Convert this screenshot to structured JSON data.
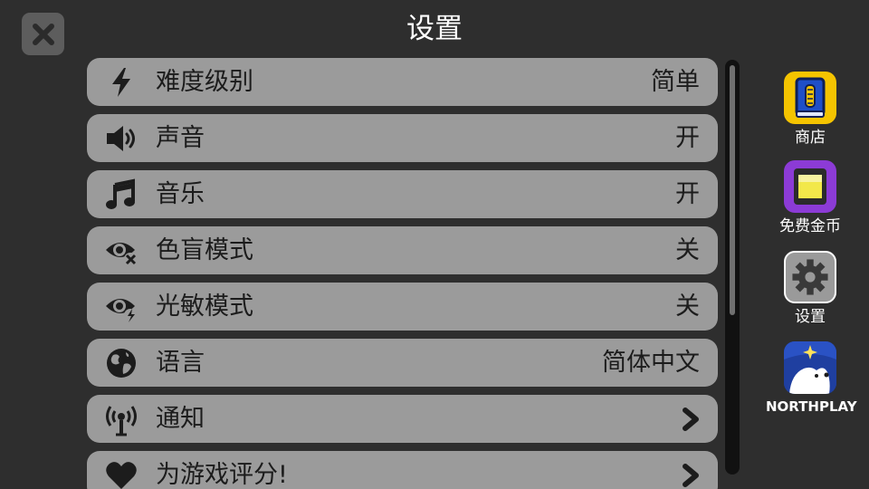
{
  "header": {
    "title": "设置",
    "close_icon": "close-x-icon"
  },
  "settings": [
    {
      "icon": "lightning-icon",
      "label": "难度级别",
      "value": "简单"
    },
    {
      "icon": "speaker-icon",
      "label": "声音",
      "value": "开"
    },
    {
      "icon": "music-note-icon",
      "label": "音乐",
      "value": "开"
    },
    {
      "icon": "colorblind-eye-icon",
      "label": "色盲模式",
      "value": "关"
    },
    {
      "icon": "photosensitive-eye-icon",
      "label": "光敏模式",
      "value": "关"
    },
    {
      "icon": "globe-icon",
      "label": "语言",
      "value": "简体中文"
    },
    {
      "icon": "broadcast-icon",
      "label": "通知",
      "value": null
    },
    {
      "icon": "heart-icon",
      "label": "为游戏评分!",
      "value": null
    }
  ],
  "sidebar": {
    "shop": {
      "label": "商店",
      "icon": "shop-book-icon"
    },
    "free_coins": {
      "label": "免费金币",
      "icon": "free-coins-tv-icon"
    },
    "settings": {
      "label": "设置",
      "icon": "gear-icon"
    },
    "brand": {
      "label": "NORTHPLAY",
      "icon": "polar-bear-logo"
    }
  },
  "colors": {
    "background": "#2e2e2e",
    "row": "#9b9b9b",
    "text_dark": "#1c1c1c",
    "text_light": "#ffffff",
    "shop_tile": "#f5c400",
    "coins_tile": "#8c3bd6",
    "settings_tile": "#9a9a9a",
    "brand_tile": "#1f3fa0"
  }
}
